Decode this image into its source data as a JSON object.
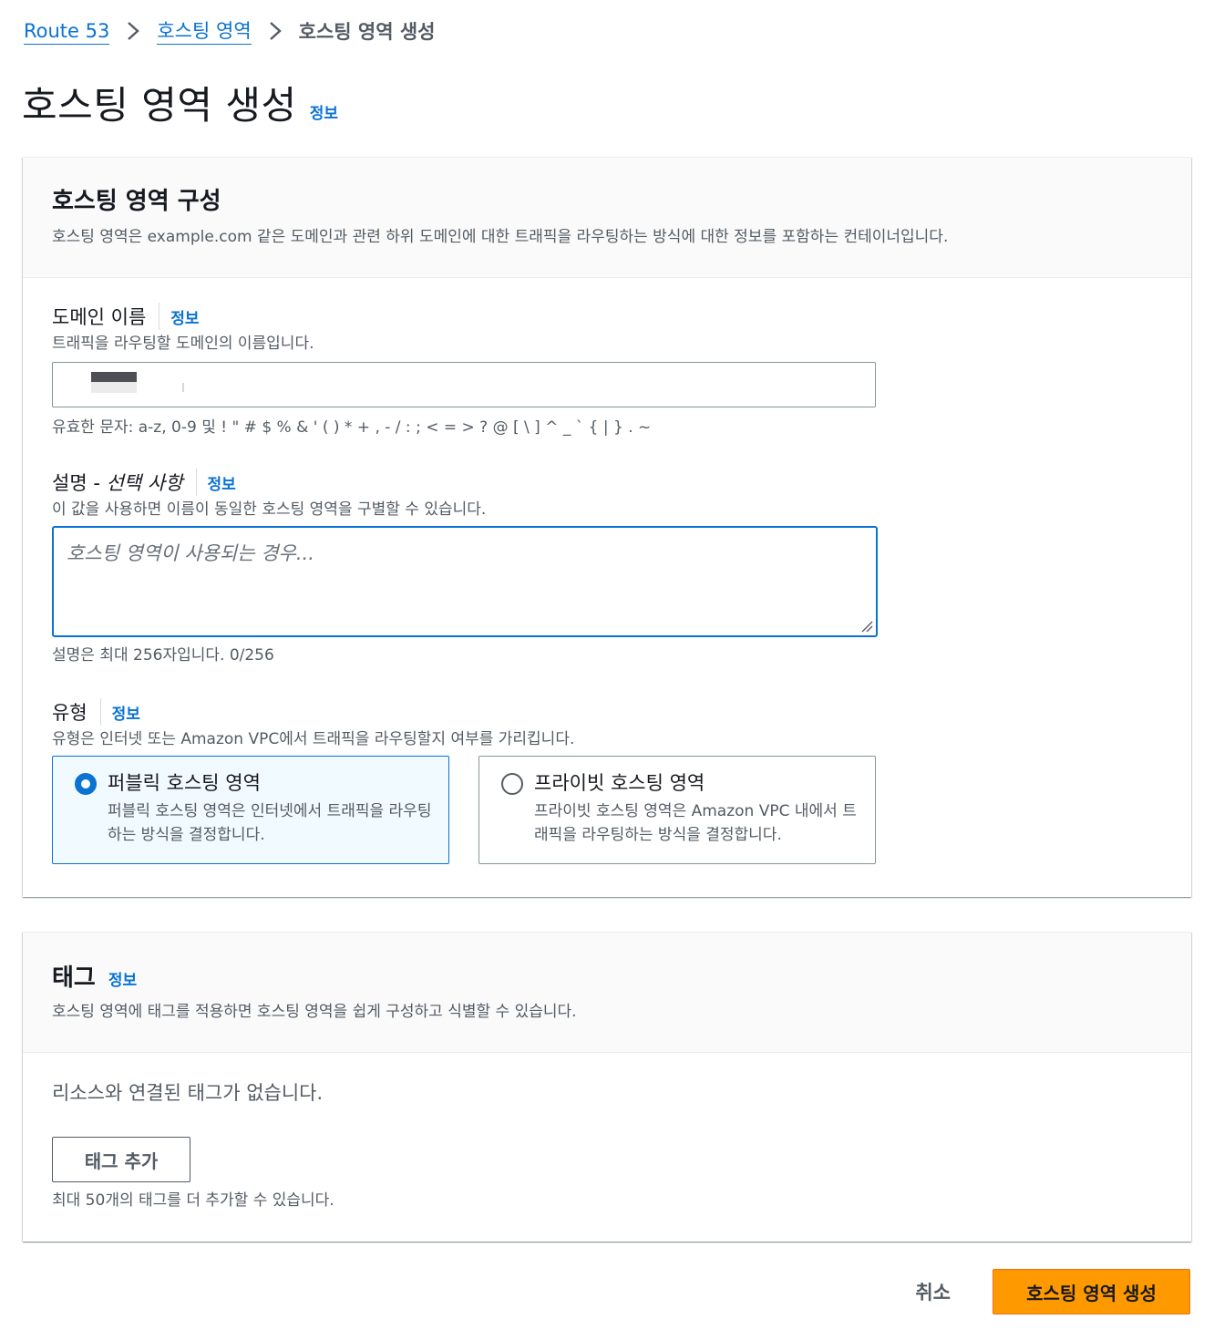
{
  "breadcrumb": {
    "items": [
      "Route 53",
      "호스팅 영역"
    ],
    "current": "호스팅 영역 생성"
  },
  "page": {
    "title": "호스팅 영역 생성",
    "info": "정보"
  },
  "config": {
    "title": "호스팅 영역 구성",
    "description": "호스팅 영역은 example.com 같은 도메인과 관련 하위 도메인에 대한 트래픽을 라우팅하는 방식에 대한 정보를 포함하는 컨테이너입니다.",
    "domain": {
      "label": "도메인 이름",
      "info": "정보",
      "description": "트래픽을 라우팅할 도메인의 이름입니다.",
      "value": "",
      "constraint": "유효한 문자: a-z, 0-9 및 ! \" # $ % & ' ( ) * + , - / : ; < = > ? @ [ \\ ] ^ _ ` { | } . ~"
    },
    "description_field": {
      "label": "설명 - ",
      "label_optional": "선택 사항",
      "info": "정보",
      "description": "이 값을 사용하면 이름이 동일한 호스팅 영역을 구별할 수 있습니다.",
      "placeholder": "호스팅 영역이 사용되는 경우...",
      "value": "",
      "constraint": "설명은 최대 256자입니다. 0/256"
    },
    "type": {
      "label": "유형",
      "info": "정보",
      "description": "유형은 인터넷 또는 Amazon VPC에서 트래픽을 라우팅할지 여부를 가리킵니다.",
      "selected": "public",
      "options": [
        {
          "title": "퍼블릭 호스팅 영역",
          "description": "퍼블릭 호스팅 영역은 인터넷에서 트래픽을 라우팅하는 방식을 결정합니다."
        },
        {
          "title": "프라이빗 호스팅 영역",
          "description": "프라이빗 호스팅 영역은 Amazon VPC 내에서 트래픽을 라우팅하는 방식을 결정합니다."
        }
      ]
    }
  },
  "tags": {
    "title": "태그",
    "info": "정보",
    "description": "호스팅 영역에 태그를 적용하면 호스팅 영역을 쉽게 구성하고 식별할 수 있습니다.",
    "empty": "리소스와 연결된 태그가 없습니다.",
    "add_button": "태그 추가",
    "limit_hint": "최대 50개의 태그를 더 추가할 수 있습니다."
  },
  "actions": {
    "cancel": "취소",
    "submit": "호스팅 영역 생성"
  },
  "colors": {
    "link": "#0972d3",
    "primary": "#ff9900",
    "selected_bg": "#f1faff"
  }
}
